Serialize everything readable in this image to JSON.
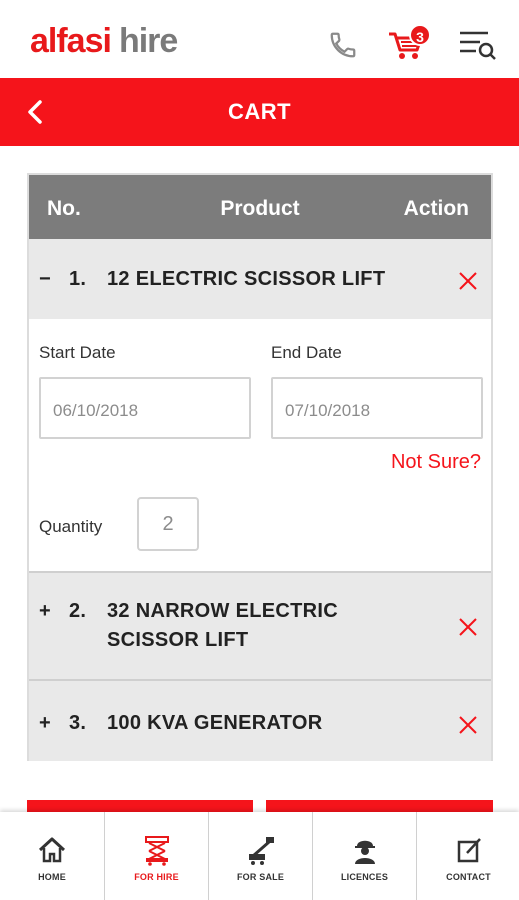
{
  "header": {
    "logo_brand": "alfasi",
    "logo_sub": "hire",
    "cart_count": "3"
  },
  "title_bar": {
    "title": "CART"
  },
  "table": {
    "columns": {
      "no": "No.",
      "product": "Product",
      "action": "Action"
    },
    "items": [
      {
        "toggle": "−",
        "number": "1.",
        "name": "12 ELECTRIC SCISSOR LIFT",
        "expanded": true,
        "start_date_label": "Start Date",
        "end_date_label": "End Date",
        "start_date": "06/10/2018",
        "end_date": "07/10/2018",
        "not_sure": "Not Sure?",
        "quantity_label": "Quantity",
        "quantity": "2"
      },
      {
        "toggle": "+",
        "number": "2.",
        "name": "32 NARROW ELECTRIC SCISSOR LIFT",
        "expanded": false
      },
      {
        "toggle": "+",
        "number": "3.",
        "name": "100 KVA GENERATOR",
        "expanded": false
      }
    ]
  },
  "bottom_nav": {
    "items": [
      {
        "label": "HOME",
        "icon": "home-icon"
      },
      {
        "label": "FOR HIRE",
        "icon": "scissor-lift-icon",
        "active": true
      },
      {
        "label": "FOR SALE",
        "icon": "boom-lift-icon"
      },
      {
        "label": "LICENCES",
        "icon": "worker-icon"
      },
      {
        "label": "CONTACT",
        "icon": "edit-note-icon"
      }
    ]
  },
  "colors": {
    "brand_red": "#f5141b",
    "table_header": "#7c7c7c",
    "row_bg": "#e9e9e9"
  }
}
